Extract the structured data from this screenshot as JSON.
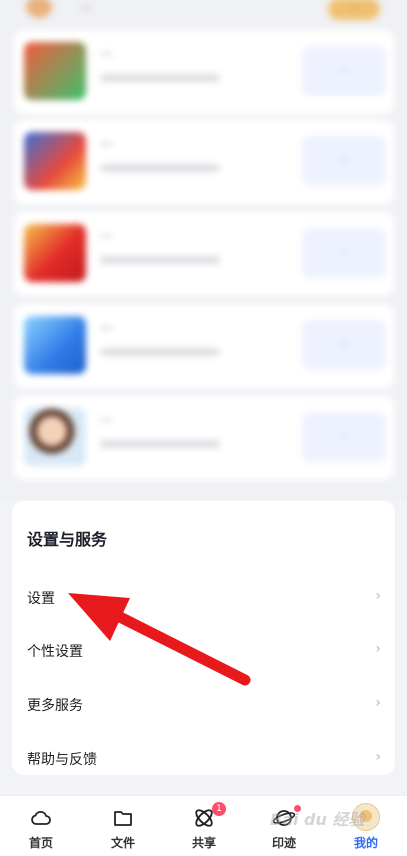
{
  "colors": {
    "page_bg": "#f2f3f7",
    "card_bg": "#ffffff",
    "accent": "#2f6bff",
    "arrow": "#e8191c",
    "badge": "#ff4d6a"
  },
  "promo": {
    "top_text": "···",
    "top_badge": "···",
    "cards": [
      {
        "title": "···",
        "button": "···"
      },
      {
        "title": "···",
        "button": "···"
      },
      {
        "title": "···",
        "button": "···"
      },
      {
        "title": "···",
        "button": "···"
      },
      {
        "title": "···",
        "button": "···"
      }
    ]
  },
  "settings": {
    "title": "设置与服务",
    "items": [
      {
        "label": "设置",
        "icon": "chevron-right-icon"
      },
      {
        "label": "个性设置",
        "icon": "chevron-right-icon"
      },
      {
        "label": "更多服务",
        "icon": "chevron-right-icon"
      },
      {
        "label": "帮助与反馈",
        "icon": "chevron-right-icon"
      }
    ]
  },
  "tabbar": {
    "tabs": [
      {
        "label": "首页",
        "icon": "cloud-icon",
        "active": false
      },
      {
        "label": "文件",
        "icon": "folder-icon",
        "active": false
      },
      {
        "label": "共享",
        "icon": "atom-icon",
        "active": false,
        "badge": "1"
      },
      {
        "label": "印迹",
        "icon": "planet-icon",
        "active": false,
        "dot": true
      },
      {
        "label": "我的",
        "icon": "avatar-icon",
        "active": true
      }
    ]
  },
  "watermark": "Bai du 经验"
}
